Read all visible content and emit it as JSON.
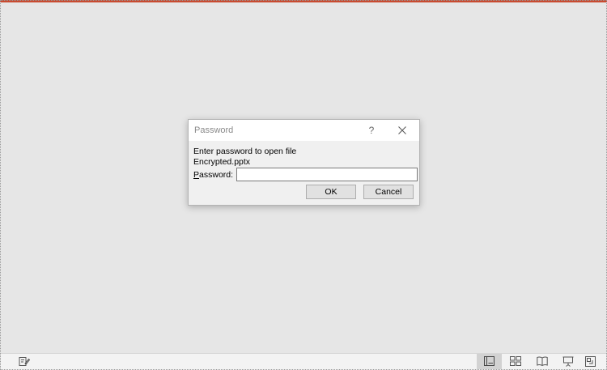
{
  "dialog": {
    "title": "Password",
    "help_label": "?",
    "prompt": "Enter password to open file",
    "file_name": "Encrypted.pptx",
    "password_label_accel": "P",
    "password_label_rest": "assword:",
    "password_value": "",
    "ok_label": "OK",
    "cancel_label": "Cancel"
  },
  "statusbar": {
    "icons": [
      "notes-icon",
      "normal-view-icon",
      "slide-sorter-icon",
      "reading-view-icon",
      "slideshow-icon",
      "fit-to-window-icon"
    ],
    "active_view": "normal-view-icon"
  },
  "colors": {
    "accent": "#c84b31",
    "workspace": "#e6e6e6",
    "dialog_bg": "#f0f0f0",
    "button_bg": "#e1e1e1"
  }
}
